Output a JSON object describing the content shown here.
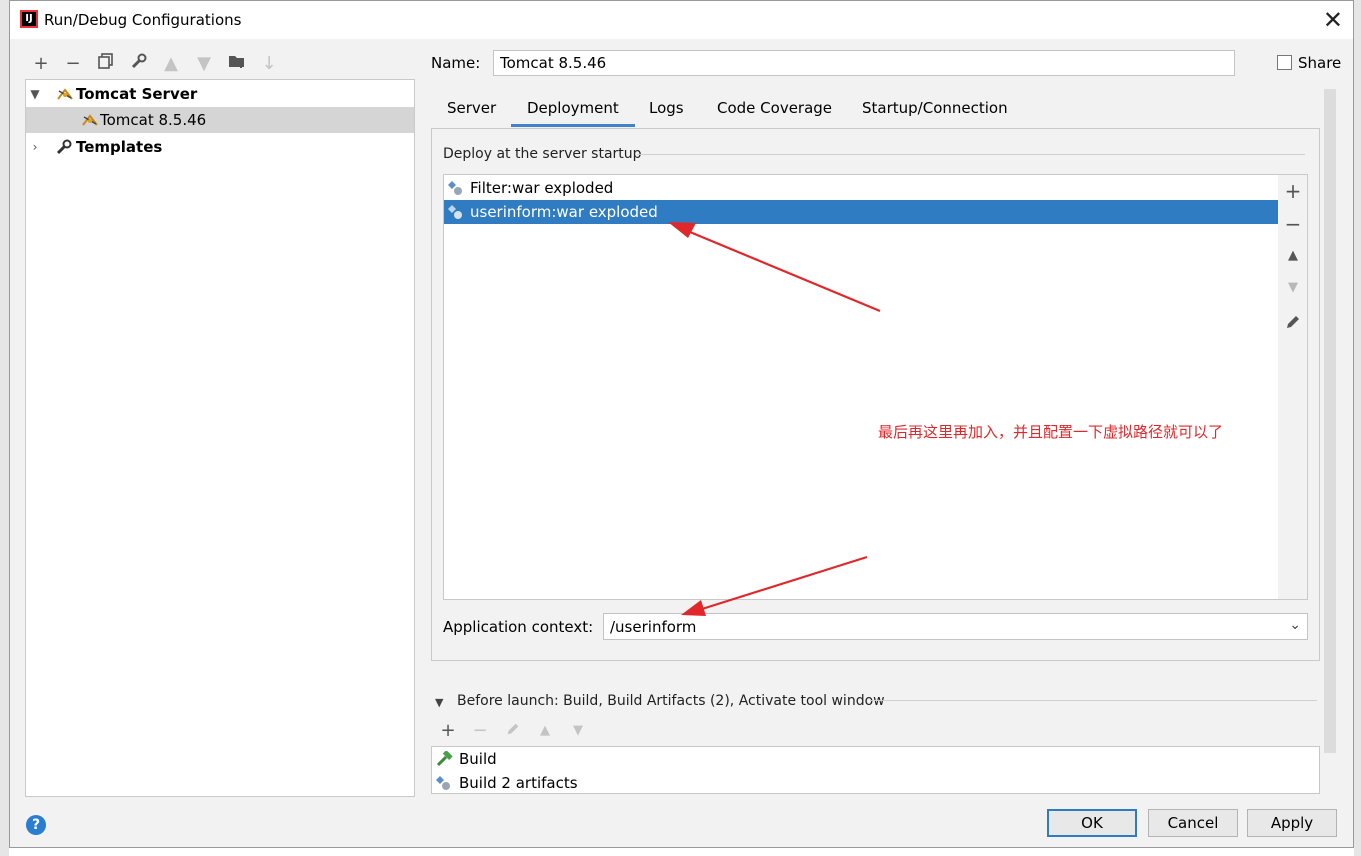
{
  "window": {
    "title": "Run/Debug Configurations",
    "app_icon_letters": "IJ"
  },
  "toolbar": {
    "icons": [
      "add-icon",
      "remove-icon",
      "copy-icon",
      "wrench-icon",
      "move-up-icon",
      "move-down-icon",
      "folder-add-icon",
      "sort-icon"
    ]
  },
  "tree": {
    "group_label": "Tomcat Server",
    "child_label": "Tomcat 8.5.46",
    "templates_label": "Templates"
  },
  "name_field": {
    "label": "Name:",
    "value": "Tomcat 8.5.46"
  },
  "share": {
    "label": "Share",
    "checked": false
  },
  "tabs": [
    {
      "label": "Server",
      "active": false
    },
    {
      "label": "Deployment",
      "active": true
    },
    {
      "label": "Logs",
      "active": false
    },
    {
      "label": "Code Coverage",
      "active": false
    },
    {
      "label": "Startup/Connection",
      "active": false
    }
  ],
  "deployment": {
    "section_title": "Deploy at the server startup",
    "items": [
      {
        "label": "Filter:war exploded",
        "selected": false
      },
      {
        "label": "userinform:war exploded",
        "selected": true
      }
    ],
    "side_tools": [
      "add-icon",
      "remove-icon",
      "move-up-icon",
      "move-down-icon",
      "edit-icon"
    ]
  },
  "annotation": {
    "text": "最后再这里再加入，并且配置一下虚拟路径就可以了",
    "color": "#e0282b"
  },
  "application_context": {
    "label": "Application context:",
    "value": "/userinform"
  },
  "before_launch": {
    "title": "Before launch: Build, Build Artifacts (2), Activate tool window",
    "items": [
      "Build",
      "Build 2 artifacts"
    ]
  },
  "buttons": {
    "ok": "OK",
    "cancel": "Cancel",
    "apply": "Apply",
    "help": "?"
  },
  "colors": {
    "selection": "#2f7cc3",
    "accent": "#4083c9"
  }
}
